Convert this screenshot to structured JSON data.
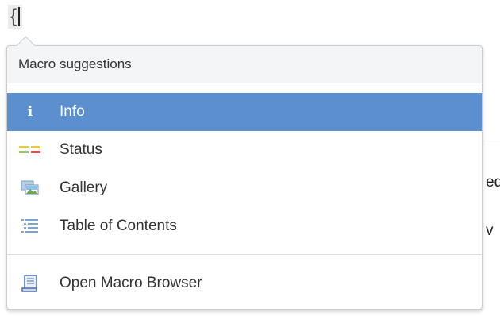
{
  "editor": {
    "typed_text": "{",
    "background_snippets": [
      "ed",
      "v"
    ]
  },
  "popup": {
    "header": "Macro suggestions",
    "items": [
      {
        "label": "Info",
        "icon": "info-icon",
        "selected": true
      },
      {
        "label": "Status",
        "icon": "status-icon",
        "selected": false
      },
      {
        "label": "Gallery",
        "icon": "gallery-icon",
        "selected": false
      },
      {
        "label": "Table of Contents",
        "icon": "table-of-contents-icon",
        "selected": false
      }
    ],
    "footer_item": {
      "label": "Open Macro Browser",
      "icon": "macro-browser-icon"
    }
  },
  "colors": {
    "selected_bg": "#5b8fcd",
    "header_bg": "#f4f5f7",
    "status_yellow": "#e6c84a",
    "status_red": "#d9534f",
    "toc_blue": "#7aa3d6"
  }
}
